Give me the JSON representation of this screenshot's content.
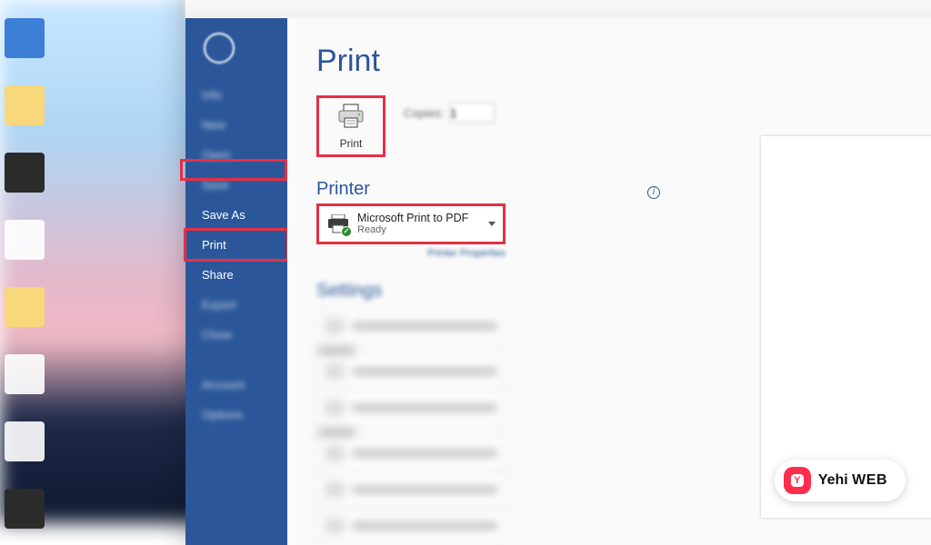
{
  "sidebar": {
    "items": [
      {
        "label": "Info"
      },
      {
        "label": "New"
      },
      {
        "label": "Open"
      },
      {
        "label": "Save"
      },
      {
        "label": "Save As"
      },
      {
        "label": "Print"
      },
      {
        "label": "Share"
      },
      {
        "label": "Export"
      },
      {
        "label": "Close"
      },
      {
        "label": "Account"
      },
      {
        "label": "Options"
      }
    ]
  },
  "main": {
    "title": "Print",
    "print_button_label": "Print",
    "copies_label": "Copies:",
    "copies_value": "1",
    "printer_section_title": "Printer",
    "printer_properties": "Printer Properties",
    "selected_printer": {
      "name": "Microsoft Print to PDF",
      "status": "Ready"
    },
    "settings_section_title": "Settings"
  },
  "watermark": {
    "brand_a": "Yehi",
    "brand_b": "WEB"
  }
}
